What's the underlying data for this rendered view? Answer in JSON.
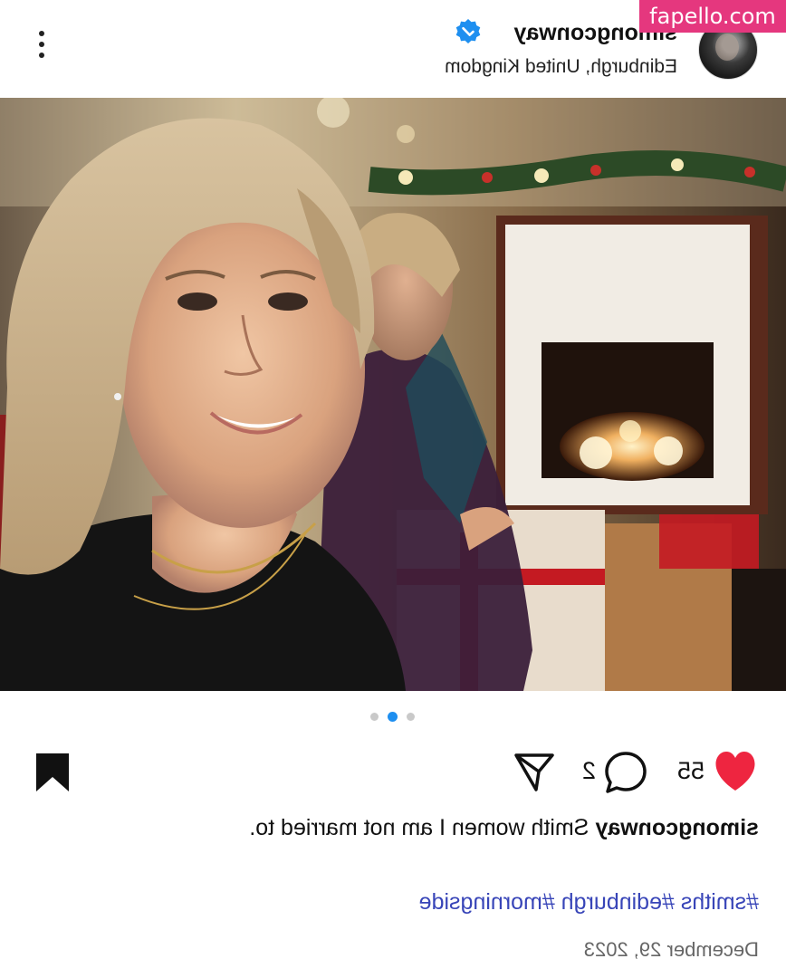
{
  "header": {
    "username": "simongconway",
    "location": "Edinburgh, United Kingdom",
    "verified_color": "#1e8ff0"
  },
  "watermark": "fapello.com",
  "carousel": {
    "count": 3,
    "active_index": 1
  },
  "actions": {
    "like_count": "55",
    "comment_count": "2",
    "like_color": "#ee2540"
  },
  "post": {
    "author": "simongconway",
    "caption": "Smith women I am not married to.",
    "hashtags": [
      "#smiths",
      "#edinburgh",
      "#morningside"
    ],
    "date": "December 29, 2023",
    "hashtag_color": "#3845b8"
  }
}
